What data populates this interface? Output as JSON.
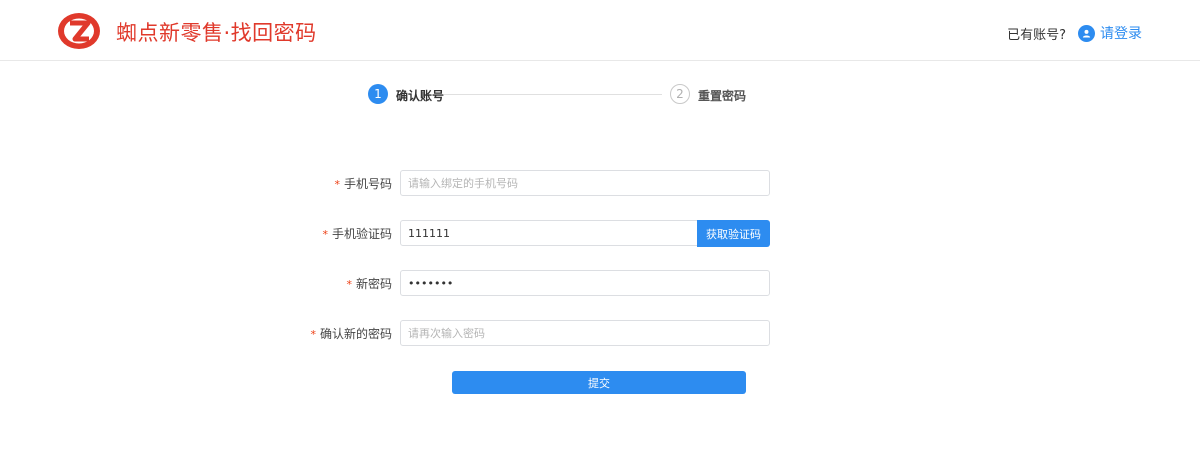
{
  "header": {
    "brand": "蜘点新零售·找回密码",
    "has_account": "已有账号?",
    "login_link": "请登录",
    "accent_color": "#2d8cf0",
    "brand_color": "#e0392b"
  },
  "steps": [
    {
      "number": "1",
      "label": "确认账号",
      "state": "active"
    },
    {
      "number": "2",
      "label": "重置密码",
      "state": "inactive"
    }
  ],
  "form": {
    "phone": {
      "label": "手机号码",
      "value": "",
      "placeholder": "请输入绑定的手机号码"
    },
    "code": {
      "label": "手机验证码",
      "value": "111111",
      "placeholder": "",
      "button_label": "获取验证码"
    },
    "new_password": {
      "label": "新密码",
      "value": "1234567",
      "placeholder": ""
    },
    "confirm_password": {
      "label": "确认新的密码",
      "value": "",
      "placeholder": "请再次输入密码"
    },
    "required_mark": "*",
    "submit_label": "提交"
  }
}
